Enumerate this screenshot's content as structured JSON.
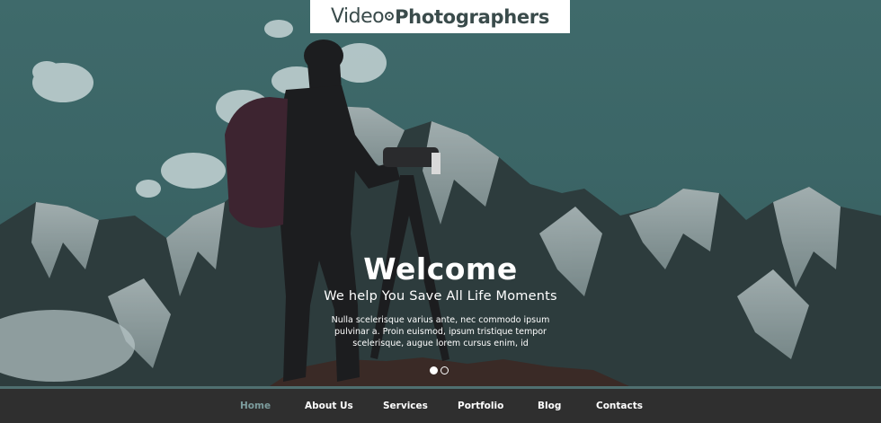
{
  "logo": {
    "part_light": "Video",
    "part_bold": "Photographers"
  },
  "slide": {
    "heading": "Welcome",
    "subheading": "We help You Save All Life Moments",
    "body": "Nulla scelerisque varius ante, nec commodo ipsum pulvinar a. Proin euismod, ipsum tristique tempor scelerisque, augue lorem cursus enim, id",
    "total_slides": 2,
    "active_slide": 1
  },
  "nav": {
    "items": [
      {
        "label": "Home",
        "active": true
      },
      {
        "label": "About Us",
        "active": false
      },
      {
        "label": "Services",
        "active": false
      },
      {
        "label": "Portfolio",
        "active": false
      },
      {
        "label": "Blog",
        "active": false
      },
      {
        "label": "Contacts",
        "active": false
      }
    ]
  },
  "colors": {
    "sky": "#3f6a6b",
    "nav_background": "#2f2f2f",
    "nav_active": "#7c9c9d",
    "text": "#ffffff"
  }
}
